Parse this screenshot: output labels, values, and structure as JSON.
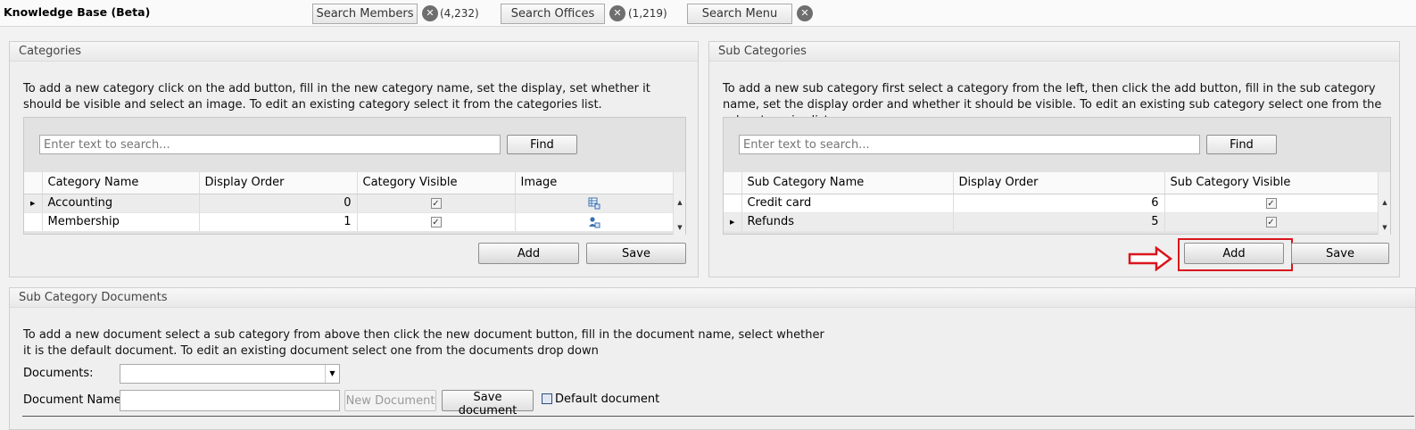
{
  "topbar": {
    "title": "Knowledge Base (Beta)",
    "search_members_label": "Search Members",
    "members_count": "(4,232)",
    "search_offices_label": "Search Offices",
    "offices_count": "(1,219)",
    "search_menu_label": "Search Menu",
    "clear_glyph": "✕"
  },
  "categories": {
    "header": "Categories",
    "description": "To add a new category click on the add button, fill in the new category name, set the display, set whether it should be visible and select an image. To edit an existing category select it from the categories list.",
    "search_placeholder": "Enter text to search...",
    "find_label": "Find",
    "columns": [
      "Category Name",
      "Display Order",
      "Category Visible",
      "Image"
    ],
    "rows": [
      {
        "name": "Accounting",
        "order": "0",
        "visible": true,
        "image": "table-icon"
      },
      {
        "name": "Membership",
        "order": "1",
        "visible": true,
        "image": "member-icon"
      }
    ],
    "add_label": "Add",
    "save_label": "Save"
  },
  "subcategories": {
    "header": "Sub Categories",
    "description": "To add a new sub category first select a category from the left, then click the add button, fill in the sub category name, set the display order and whether it should be visible. To edit an existing sub category select one from the sub categories list.",
    "search_placeholder": "Enter text to search...",
    "find_label": "Find",
    "columns": [
      "Sub Category Name",
      "Display Order",
      "Sub Category Visible"
    ],
    "rows": [
      {
        "name": "Credit card",
        "order": "6",
        "visible": true
      },
      {
        "name": "Refunds",
        "order": "5",
        "visible": true
      }
    ],
    "add_label": "Add",
    "save_label": "Save",
    "highlight_color": "#d9151c"
  },
  "documents": {
    "header": "Sub Category Documents",
    "description": "To add a new document select a sub category from above then click the new document button, fill in the document name, select whether it is the default document. To edit an existing document select one from the documents drop down",
    "documents_label": "Documents:",
    "document_name_label": "Document Name:",
    "documents_value": "",
    "document_name_value": "",
    "new_document_label": "New Document",
    "save_document_label": "Save document",
    "default_document_label": "Default document"
  }
}
